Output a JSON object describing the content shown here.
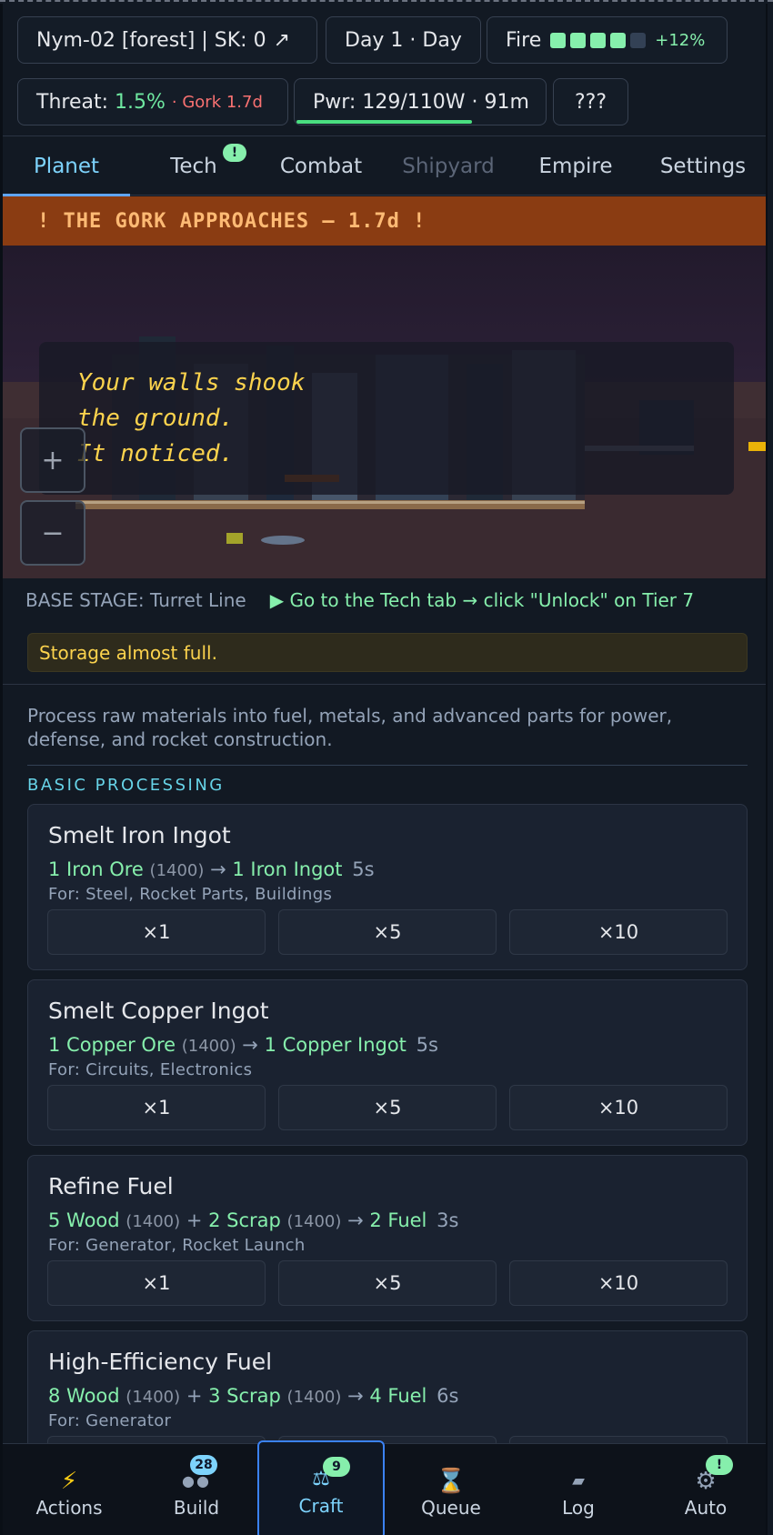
{
  "status": {
    "planet": "Nym-02 [forest] | SK: 0",
    "planet_arrow": "↗",
    "day": "Day 1 · Day",
    "fire_label": "Fire",
    "fire_level": 4,
    "fire_max": 5,
    "fire_pct": "+12%",
    "threat_label": "Threat:",
    "threat_value": "1.5%",
    "threat_gork": "· Gork 1.7d",
    "power": "Pwr: 129/110W · 91m",
    "power_fraction": 0.7,
    "unknown": "???"
  },
  "tabs": [
    {
      "label": "Planet",
      "state": "active"
    },
    {
      "label": "Tech",
      "badge": "!"
    },
    {
      "label": "Combat"
    },
    {
      "label": "Shipyard",
      "state": "disabled"
    },
    {
      "label": "Empire"
    },
    {
      "label": "Settings"
    }
  ],
  "banner": "! THE GORK APPROACHES — 1.7d !",
  "scene": {
    "narration": [
      "Your walls shook",
      "the ground.",
      "It noticed."
    ],
    "zoom_in": "+",
    "zoom_out": "−"
  },
  "stage": {
    "label": "BASE STAGE: Turret Line",
    "hint": "▶ Go to the Tech tab → click \"Unlock\" on Tier 7"
  },
  "alert": "Storage almost full.",
  "craft": {
    "description": "Process raw materials into fuel, metals, and advanced parts for power, defense, and rocket construction.",
    "section": "BASIC PROCESSING",
    "buttons": [
      "×1",
      "×5",
      "×10"
    ],
    "recipes": [
      {
        "title": "Smelt Iron Ingot",
        "in1": "1 Iron Ore",
        "in1_stock": "(1400)",
        "out": "1 Iron Ingot",
        "time": "5s",
        "for": "For: Steel, Rocket Parts, Buildings"
      },
      {
        "title": "Smelt Copper Ingot",
        "in1": "1 Copper Ore",
        "in1_stock": "(1400)",
        "out": "1 Copper Ingot",
        "time": "5s",
        "for": "For: Circuits, Electronics"
      },
      {
        "title": "Refine Fuel",
        "in1": "5 Wood",
        "in1_stock": "(1400)",
        "in2": "2 Scrap",
        "in2_stock": "(1400)",
        "out": "2 Fuel",
        "time": "3s",
        "for": "For: Generator, Rocket Launch"
      },
      {
        "title": "High-Efficiency Fuel",
        "in1": "8 Wood",
        "in1_stock": "(1400)",
        "in2": "3 Scrap",
        "in2_stock": "(1400)",
        "out": "4 Fuel",
        "time": "6s",
        "for": "For: Generator"
      }
    ]
  },
  "nav": [
    {
      "label": "Actions",
      "icon": "lightning-icon",
      "glyph": "⚡"
    },
    {
      "label": "Build",
      "icon": "build-icon",
      "glyph": "●●",
      "badge": "28"
    },
    {
      "label": "Craft",
      "icon": "craft-icon",
      "glyph": "⚖",
      "badge": "9",
      "active": true
    },
    {
      "label": "Queue",
      "icon": "hourglass-icon",
      "glyph": "⌛"
    },
    {
      "label": "Log",
      "icon": "log-icon",
      "glyph": "▰"
    },
    {
      "label": "Auto",
      "icon": "gear-icon",
      "glyph": "⚙",
      "badge": "!"
    }
  ],
  "colors": {
    "accent": "#7dd3fc",
    "good": "#86efac",
    "warn": "#fcd34d",
    "danger": "#f87171",
    "banner_bg": "#8a3c12"
  }
}
